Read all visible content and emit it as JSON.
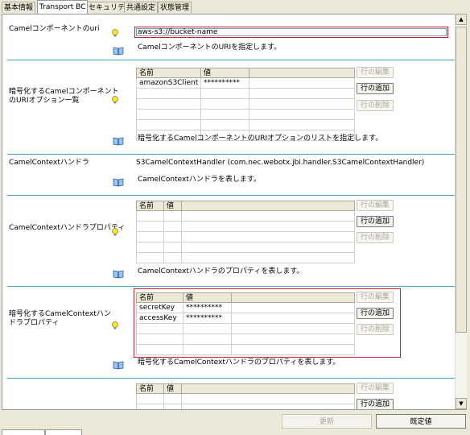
{
  "tabs": [
    "基本情報",
    "Transport BC",
    "セキュリティ",
    "共通設定",
    "状態管理"
  ],
  "active_tab": 1,
  "sections": {
    "uri": {
      "label": "Camelコンポーネントのuri",
      "value": "aws-s3://bucket-name",
      "description": "CamelコンポーネントのURIを指定します。"
    },
    "encrypted_uri_options": {
      "label_line1": "暗号化するCamelコンポーネント",
      "label_line2": "のURIオプション一覧",
      "headers": [
        "名前",
        "値"
      ],
      "rows": [
        [
          "amazonS3Client",
          "**********"
        ],
        [
          "",
          ""
        ],
        [
          "",
          ""
        ],
        [
          "",
          ""
        ],
        [
          "",
          ""
        ],
        [
          "",
          ""
        ]
      ],
      "description": "暗号化するCamelコンポーネントのURIオプションのリストを指定します。"
    },
    "context_handler": {
      "label": "CamelContextハンドラ",
      "value": "S3CamelContextHandler (com.nec.webotx.jbi.handler.S3CamelContextHandler)",
      "description": "CamelContextハンドラを表します。"
    },
    "handler_properties": {
      "label": "CamelContextハンドラプロパティ",
      "headers": [
        "名前",
        "値"
      ],
      "rows": [
        [
          "",
          ""
        ],
        [
          "",
          ""
        ],
        [
          "",
          ""
        ],
        [
          "",
          ""
        ],
        [
          "",
          ""
        ]
      ],
      "description": "CamelContextハンドラのプロパティを表します。"
    },
    "encrypted_handler_properties": {
      "label_line1": "暗号化するCamelContextハン",
      "label_line2": "ドラプロパティ",
      "headers": [
        "名前",
        "値"
      ],
      "rows": [
        [
          "secretKey",
          "**********"
        ],
        [
          "accessKey",
          "**********"
        ],
        [
          "",
          ""
        ],
        [
          "",
          ""
        ],
        [
          "",
          ""
        ]
      ],
      "description": "暗号化するCamelContextハンドラのプロパティを表します。"
    },
    "extra_table": {
      "headers": [
        "名前",
        "値"
      ]
    }
  },
  "row_buttons": {
    "edit": "行の編集",
    "add": "行の追加",
    "delete": "行の削除"
  },
  "footer": {
    "update": "更新",
    "default": "既定値"
  }
}
